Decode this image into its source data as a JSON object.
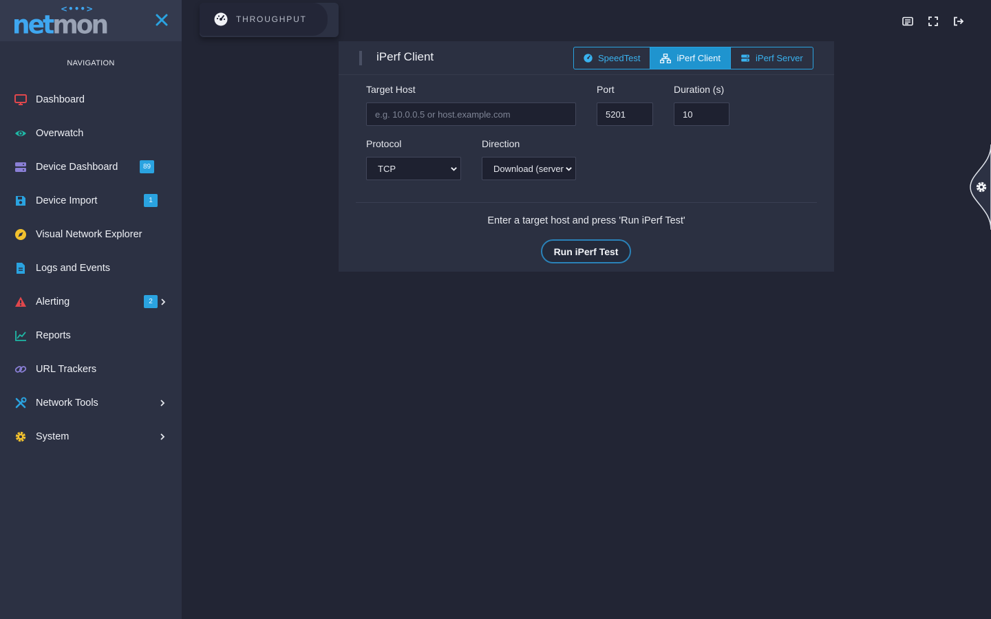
{
  "brand": {
    "logo_part1": "net",
    "logo_part2": "mon",
    "logo_dots": "<•••>"
  },
  "sidebar": {
    "heading": "NAVIGATION",
    "items": [
      {
        "label": "Dashboard",
        "icon": "monitor-icon",
        "color": "#e0474c"
      },
      {
        "label": "Overwatch",
        "icon": "eye-icon",
        "color": "#1fb8a6"
      },
      {
        "label": "Device Dashboard",
        "icon": "server-icon",
        "color": "#8a7fd6",
        "badge": "89"
      },
      {
        "label": "Device Import",
        "icon": "save-icon",
        "color": "#2aa3e0",
        "badge": "1"
      },
      {
        "label": "Visual Network Explorer",
        "icon": "compass-icon",
        "color": "#f2c12e"
      },
      {
        "label": "Logs and Events",
        "icon": "file-icon",
        "color": "#2aa3e0"
      },
      {
        "label": "Alerting",
        "icon": "warning-icon",
        "color": "#e0474c",
        "badge": "2",
        "has_children": true
      },
      {
        "label": "Reports",
        "icon": "chart-line-icon",
        "color": "#1fb8a6"
      },
      {
        "label": "URL Trackers",
        "icon": "link-icon",
        "color": "#8a7fd6"
      },
      {
        "label": "Network Tools",
        "icon": "tools-icon",
        "color": "#2aa3e0",
        "has_children": true
      },
      {
        "label": "System",
        "icon": "gear-icon",
        "color": "#f2c12e",
        "has_children": true
      }
    ]
  },
  "page_tab": {
    "label": "THROUGHPUT",
    "icon": "gauge-icon"
  },
  "card": {
    "title": "iPerf Client",
    "modes": [
      {
        "label": "SpeedTest",
        "icon": "gauge-icon",
        "active": false
      },
      {
        "label": "iPerf Client",
        "icon": "network-icon",
        "active": true
      },
      {
        "label": "iPerf Server",
        "icon": "server-icon",
        "active": false
      }
    ],
    "fields": {
      "target_host": {
        "label": "Target Host",
        "placeholder": "e.g. 10.0.0.5 or host.example.com",
        "value": ""
      },
      "port": {
        "label": "Port",
        "value": "5201"
      },
      "duration": {
        "label": "Duration (s)",
        "value": "10"
      },
      "protocol": {
        "label": "Protocol",
        "value": "TCP"
      },
      "direction": {
        "label": "Direction",
        "value": "Download (server"
      }
    },
    "hint": "Enter a target host and press 'Run iPerf Test'",
    "run_label": "Run iPerf Test"
  },
  "colors": {
    "accent": "#2aa3e0",
    "background": "#222534",
    "sidebar": "#2c3143",
    "card": "#2b3041"
  }
}
